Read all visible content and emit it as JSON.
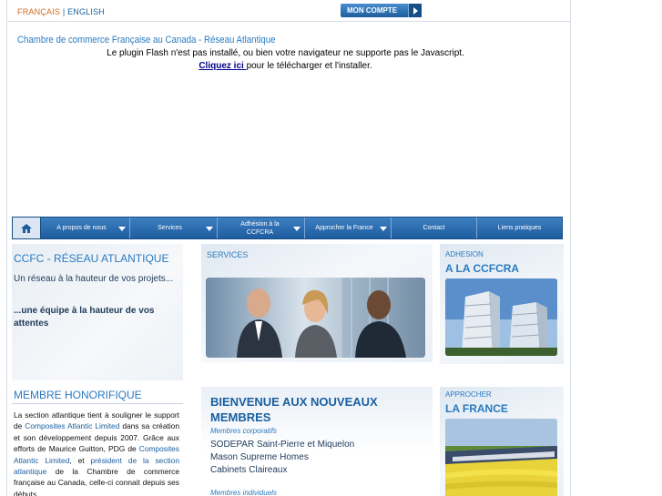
{
  "header": {
    "lang_fr": "FRANÇAIS",
    "lang_sep": "|",
    "lang_en": "ENGLISH",
    "account_button": "MON COMPTE"
  },
  "flash": {
    "title": "Chambre de commerce Française au Canada - Réseau Atlantique",
    "line1": "Le plugin Flash n'est pas installé, ou bien votre navigateur ne supporte pas le Javascript.",
    "link": "Cliquez ici ",
    "line2_rest": "pour le télécharger et l'installer."
  },
  "nav": {
    "items": [
      {
        "label": "A propos de nous",
        "dropdown": true
      },
      {
        "label": "Services",
        "dropdown": true
      },
      {
        "label": "Adhésion à la CCFCRA",
        "dropdown": true
      },
      {
        "label": "Approcher la France",
        "dropdown": true
      },
      {
        "label": "Contact",
        "dropdown": false
      },
      {
        "label": "Liens pratiques",
        "dropdown": false
      }
    ]
  },
  "left": {
    "title": "CCFC - RÉSEAU ATLANTIQUE",
    "text1": "Un réseau à la hauteur de vos projets...",
    "text2": "...une équipe à la hauteur de vos attentes",
    "honorary_title": "MEMBRE HONORIFIQUE",
    "honorary_p1": "La section atlantique tient à souligner le support de ",
    "honorary_link1": "Composites Atlantic Limited",
    "honorary_p2": " dans sa création et son développement depuis 2007. Grâce aux efforts de Maurice Guitton, PDG de ",
    "honorary_link2": "Composites Atlantic Limited",
    "honorary_p3": ", et ",
    "honorary_link3": "président de la section atlantique",
    "honorary_p4": " de la Chambre de commerce française au Canada, celle-ci connait depuis ses débuts"
  },
  "services": {
    "title": "SERVICES"
  },
  "welcome": {
    "title": "BIENVENUE AUX NOUVEAUX MEMBRES",
    "corporate_label": "Membres corporatifs",
    "members": [
      "SODEPAR Saint-Pierre et Miquelon",
      "Mason Supreme Homes",
      "Cabinets Claireaux"
    ],
    "individual_label": "Membres individuels"
  },
  "adhesion": {
    "small": "ADHESION",
    "big": "A LA CCFCRA"
  },
  "approcher": {
    "small": "APPROCHER",
    "big": "LA FRANCE"
  }
}
